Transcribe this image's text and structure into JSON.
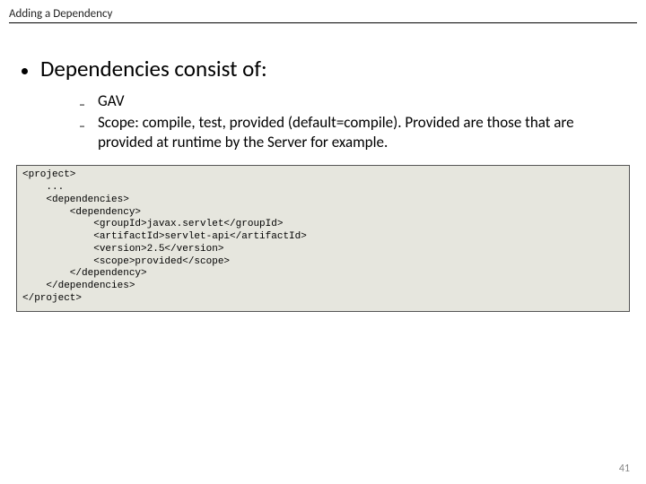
{
  "title": "Adding a Dependency",
  "main_bullet": "Dependencies consist of:",
  "sub_bullets": [
    "GAV",
    "Scope: compile, test, provided (default=compile). Provided are those that are provided at runtime by the Server for example."
  ],
  "code": "<project>\n    ...\n    <dependencies>\n        <dependency>\n            <groupId>javax.servlet</groupId>\n            <artifactId>servlet-api</artifactId>\n            <version>2.5</version>\n            <scope>provided</scope>\n        </dependency>\n    </dependencies>\n</project>",
  "page_number": "41"
}
